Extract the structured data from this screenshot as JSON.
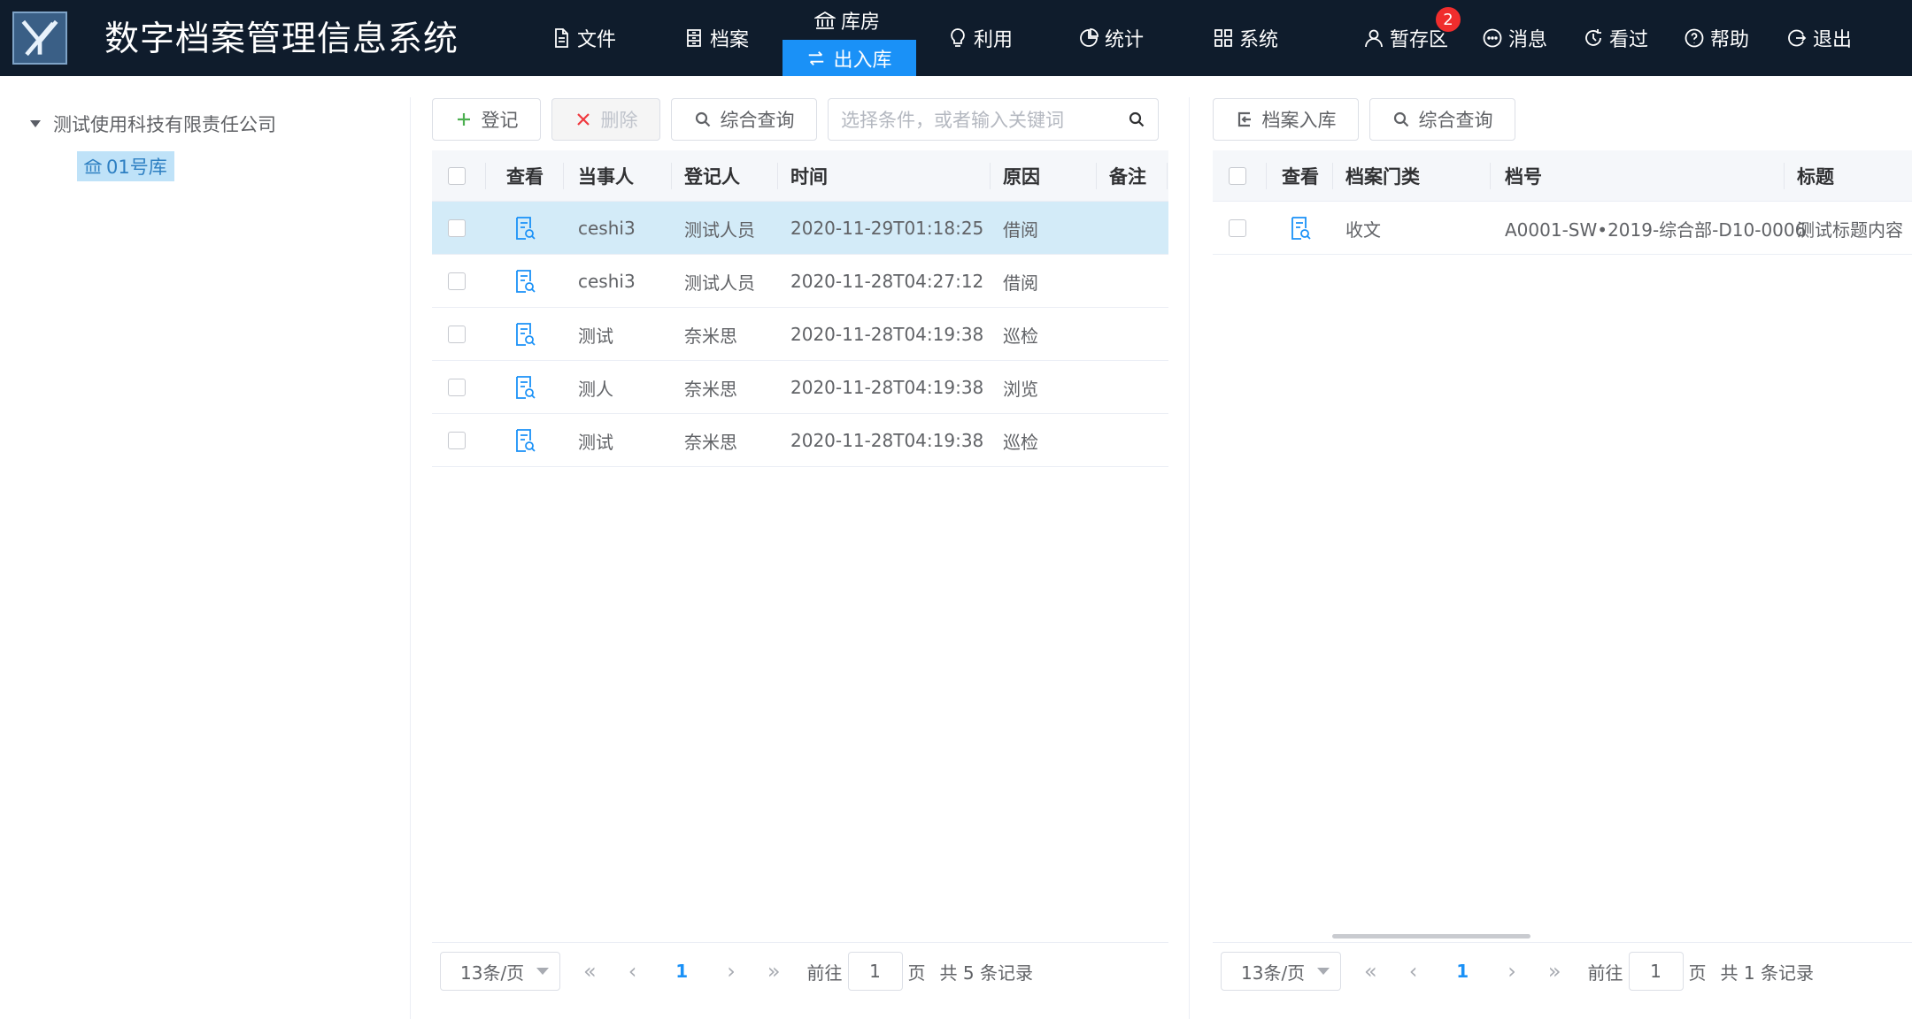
{
  "header": {
    "title": "数字档案管理信息系统",
    "nav": [
      {
        "label": "文件",
        "icon": "file-icon"
      },
      {
        "label": "档案",
        "icon": "archive-icon"
      },
      {
        "label": "库房",
        "icon": "bank-icon"
      },
      {
        "label": "利用",
        "icon": "bulb-icon"
      },
      {
        "label": "统计",
        "icon": "pie-chart-icon"
      },
      {
        "label": "系统",
        "icon": "grid-icon"
      },
      {
        "label": "暂存区",
        "icon": "user-icon"
      },
      {
        "label": "消息",
        "icon": "chat-icon"
      },
      {
        "label": "看过",
        "icon": "history-icon"
      },
      {
        "label": "帮助",
        "icon": "help-icon"
      },
      {
        "label": "退出",
        "icon": "logout-icon"
      }
    ],
    "active_sub": "出入库",
    "staging_badge": "2"
  },
  "tree": {
    "root": "测试使用科技有限责任公司",
    "child": "01号库"
  },
  "left": {
    "buttons": {
      "register": "登记",
      "delete": "删除",
      "query": "综合查询"
    },
    "search_placeholder": "选择条件，或者输入关键词",
    "columns": [
      "查看",
      "当事人",
      "登记人",
      "时间",
      "原因",
      "备注"
    ],
    "rows": [
      {
        "party": "ceshi3",
        "registrar": "测试人员",
        "time": "2020-11-29T01:18:25",
        "reason": "借阅",
        "note": ""
      },
      {
        "party": "ceshi3",
        "registrar": "测试人员",
        "time": "2020-11-28T04:27:12",
        "reason": "借阅",
        "note": ""
      },
      {
        "party": "测试",
        "registrar": "奈米思",
        "time": "2020-11-28T04:19:38",
        "reason": "巡检",
        "note": ""
      },
      {
        "party": "测人",
        "registrar": "奈米思",
        "time": "2020-11-28T04:19:38",
        "reason": "浏览",
        "note": ""
      },
      {
        "party": "测试",
        "registrar": "奈米思",
        "time": "2020-11-28T04:19:38",
        "reason": "巡检",
        "note": ""
      }
    ],
    "pager": {
      "size": "13条/页",
      "page": "1",
      "goto": "前往",
      "goto_val": "1",
      "page_unit": "页",
      "total": "共 5 条记录"
    }
  },
  "right": {
    "buttons": {
      "instore": "档案入库",
      "query": "综合查询"
    },
    "columns": [
      "查看",
      "档案门类",
      "档号",
      "标题"
    ],
    "rows": [
      {
        "category": "收文",
        "number": "A0001-SW•2019-综合部-D10-0006",
        "title": "测试标题内容"
      }
    ],
    "pager": {
      "size": "13条/页",
      "page": "1",
      "goto": "前往",
      "goto_val": "1",
      "page_unit": "页",
      "total": "共 1 条记录"
    }
  }
}
